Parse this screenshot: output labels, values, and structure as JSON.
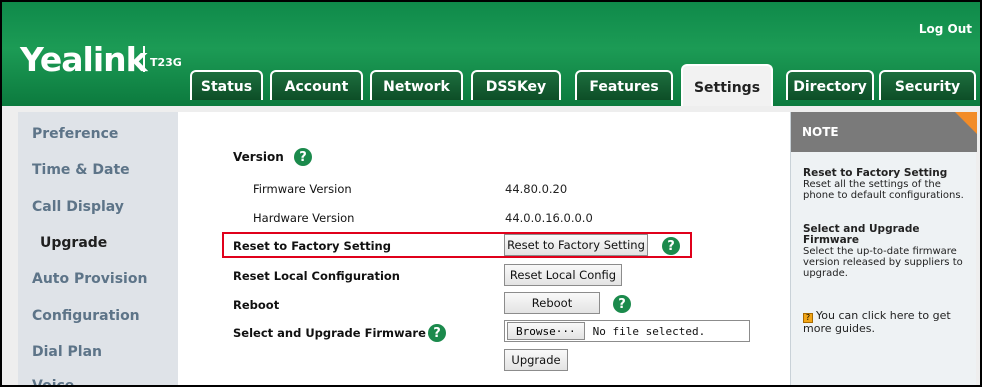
{
  "header": {
    "logo": "Yealink",
    "model": "T23G",
    "logout": "Log Out"
  },
  "tabs": [
    {
      "label": "Status"
    },
    {
      "label": "Account"
    },
    {
      "label": "Network"
    },
    {
      "label": "DSSKey"
    },
    {
      "label": "Features"
    },
    {
      "label": "Settings"
    },
    {
      "label": "Directory"
    },
    {
      "label": "Security"
    }
  ],
  "active_tab": "Settings",
  "sidebar": {
    "items": [
      {
        "label": "Preference"
      },
      {
        "label": "Time & Date"
      },
      {
        "label": "Call Display"
      },
      {
        "label": "Upgrade"
      },
      {
        "label": "Auto Provision"
      },
      {
        "label": "Configuration"
      },
      {
        "label": "Dial Plan"
      },
      {
        "label": "Voice"
      }
    ],
    "active": "Upgrade"
  },
  "main": {
    "version_label": "Version",
    "firmware_label": "Firmware Version",
    "firmware_value": "44.80.0.20",
    "hardware_label": "Hardware Version",
    "hardware_value": "44.0.0.16.0.0.0",
    "reset_factory_label": "Reset to Factory Setting",
    "reset_factory_button": "Reset to Factory Setting",
    "reset_local_label": "Reset Local Configuration",
    "reset_local_button": "Reset Local Config",
    "reboot_label": "Reboot",
    "reboot_button": "Reboot",
    "firmware_upgrade_label": "Select and Upgrade Firmware",
    "browse_button": "Browse···",
    "file_status": "No file selected.",
    "upgrade_button": "Upgrade",
    "help_glyph": "?"
  },
  "note": {
    "title": "NOTE",
    "reset_heading": "Reset to Factory Setting",
    "reset_text": "Reset all the settings of the phone to default configurations.",
    "upgrade_heading": "Select and Upgrade Firmware",
    "upgrade_text": "Select the up-to-date firmware version released by suppliers to upgrade.",
    "guide_text": "You can click here to get more guides."
  },
  "colors": {
    "header_green": "#1c9b55",
    "highlight_red": "#e0001b",
    "note_accent": "#f28c28"
  }
}
